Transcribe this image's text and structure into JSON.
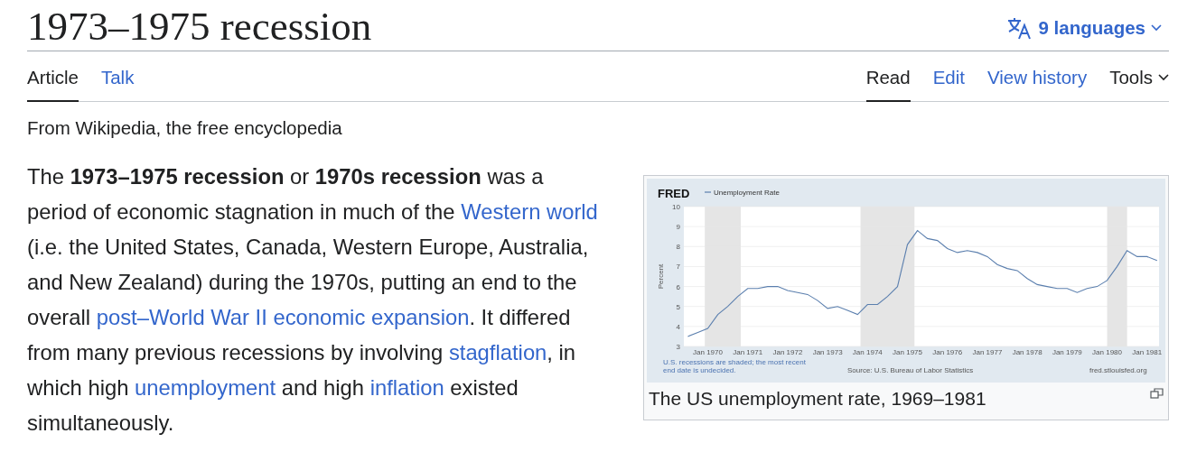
{
  "title": "1973–1975 recession",
  "languages": {
    "label": "9 languages"
  },
  "tabs_left": [
    {
      "label": "Article",
      "selected": true
    },
    {
      "label": "Talk",
      "selected": false
    }
  ],
  "tabs_right": [
    {
      "label": "Read",
      "selected": true,
      "kind": "tab"
    },
    {
      "label": "Edit",
      "selected": false,
      "kind": "tab"
    },
    {
      "label": "View history",
      "selected": false,
      "kind": "tab"
    },
    {
      "label": "Tools",
      "selected": false,
      "kind": "menu"
    }
  ],
  "tagline": "From Wikipedia, the free encyclopedia",
  "paragraph": [
    {
      "kind": "text",
      "text": "The "
    },
    {
      "kind": "bold",
      "text": "1973–1975 recession"
    },
    {
      "kind": "text",
      "text": " or "
    },
    {
      "kind": "bold",
      "text": "1970s recession"
    },
    {
      "kind": "text",
      "text": " was a period of economic stagnation in much of the "
    },
    {
      "kind": "link",
      "text": "Western world"
    },
    {
      "kind": "text",
      "text": " (i.e. the United States, Canada, Western Europe, Australia, and New Zealand) during the 1970s, putting an end to the overall "
    },
    {
      "kind": "link",
      "text": "post–World War II economic expansion"
    },
    {
      "kind": "text",
      "text": ". It differed from many previous recessions by involving "
    },
    {
      "kind": "link",
      "text": "stagflation"
    },
    {
      "kind": "text",
      "text": ", in which high "
    },
    {
      "kind": "link",
      "text": "unemployment"
    },
    {
      "kind": "text",
      "text": " and high "
    },
    {
      "kind": "link",
      "text": "inflation"
    },
    {
      "kind": "text",
      "text": " existed simultaneously."
    }
  ],
  "figure": {
    "logo": "FRED",
    "note": [
      "U.S. recessions are shaded; the most recent",
      "end date is undecided."
    ],
    "source": "Source: U.S. Bureau of Labor Statistics",
    "url": "fred.stlouisfed.org",
    "caption": "The US unemployment rate, 1969–1981",
    "chart_data": {
      "type": "line",
      "grid": true,
      "ylabel": "Percent",
      "ylim": [
        3,
        10
      ],
      "yticks": [
        3,
        4,
        5,
        6,
        7,
        8,
        9,
        10
      ],
      "categories": [
        null,
        null,
        "Jan 1970",
        null,
        null,
        null,
        "Jan 1971",
        null,
        null,
        null,
        "Jan 1972",
        null,
        null,
        null,
        "Jan 1973",
        null,
        null,
        null,
        "Jan 1974",
        null,
        null,
        null,
        "Jan 1975",
        null,
        null,
        null,
        "Jan 1976",
        null,
        null,
        null,
        "Jan 1977",
        null,
        null,
        null,
        "Jan 1978",
        null,
        null,
        null,
        "Jan 1979",
        null,
        null,
        null,
        "Jan 1980",
        null,
        null,
        null,
        "Jan 1981",
        null
      ],
      "series": [
        {
          "name": "Unemployment Rate",
          "color": "#5b7fae",
          "values": [
            3.5,
            3.7,
            3.9,
            4.6,
            5.0,
            5.5,
            5.9,
            5.9,
            6.0,
            6.0,
            5.8,
            5.7,
            5.6,
            5.3,
            4.9,
            5.0,
            4.8,
            4.6,
            5.1,
            5.1,
            5.5,
            6.0,
            8.1,
            8.8,
            8.4,
            8.3,
            7.9,
            7.7,
            7.8,
            7.7,
            7.5,
            7.1,
            6.9,
            6.8,
            6.4,
            6.1,
            6.0,
            5.9,
            5.9,
            5.7,
            5.9,
            6.0,
            6.3,
            7.0,
            7.8,
            7.5,
            7.5,
            7.3
          ]
        }
      ]
    }
  }
}
